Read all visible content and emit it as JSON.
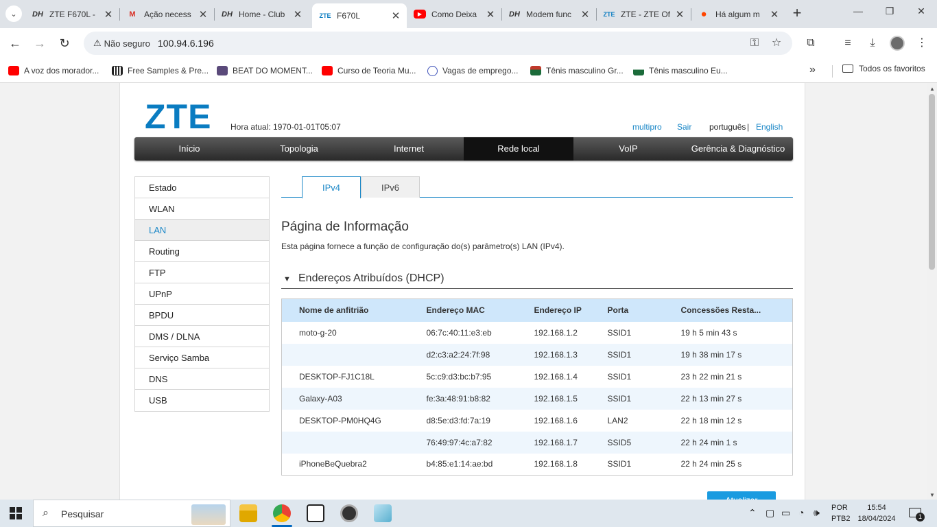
{
  "browser": {
    "tabs": [
      {
        "label": "ZTE F670L - ",
        "favicon": "DH"
      },
      {
        "label": "Ação necess",
        "favicon": "M"
      },
      {
        "label": "Home - Club",
        "favicon": "DH"
      },
      {
        "label": "F670L",
        "favicon": "ZTE"
      },
      {
        "label": "Como Deixa",
        "favicon": "▶"
      },
      {
        "label": "Modem func",
        "favicon": "DH"
      },
      {
        "label": "ZTE - ZTE Of",
        "favicon": "ZTE"
      },
      {
        "label": "Há algum m",
        "favicon": "●"
      }
    ],
    "security_label": "Não seguro",
    "url": "100.94.6.196",
    "bookmarks": [
      {
        "label": "A voz dos morador...",
        "color": "#ff0000"
      },
      {
        "label": "Free Samples & Pre...",
        "color": "#222222"
      },
      {
        "label": "BEAT DO MOMENT...",
        "color": "#5a4a7a"
      },
      {
        "label": "Curso de Teoria Mu...",
        "color": "#ff0000"
      },
      {
        "label": "Vagas de emprego...",
        "color": "#3b4fb8"
      },
      {
        "label": "Tênis masculino Gr...",
        "color": "#1b6b3a"
      },
      {
        "label": "Tênis masculino Eu...",
        "color": "#1b6b3a"
      }
    ],
    "all_bookmarks": "Todos os favoritos"
  },
  "header": {
    "logo": "ZTE",
    "time_label": "Hora atual: 1970-01-01T05:07",
    "user": "multipro",
    "logout": "Sair",
    "lang_pt": "português",
    "lang_sep": "|",
    "lang_en": "English"
  },
  "mainnav": [
    "Início",
    "Topologia",
    "Internet",
    "Rede local",
    "VoIP",
    "Gerência & Diagnóstico"
  ],
  "sidemenu": [
    "Estado",
    "WLAN",
    "LAN",
    "Routing",
    "FTP",
    "UPnP",
    "BPDU",
    "DMS / DLNA",
    "Serviço Samba",
    "DNS",
    "USB"
  ],
  "subtabs": [
    "IPv4",
    "IPv6"
  ],
  "page": {
    "title": "Página de Informação",
    "description": "Esta página fornece a função de configuração do(s) parâmetro(s) LAN (IPv4).",
    "section_title": "Endereços Atribuídos (DHCP)",
    "apply_label": "Atualizar"
  },
  "table": {
    "headers": [
      "Nome de anfitrião",
      "Endereço MAC",
      "Endereço IP",
      "Porta",
      "Concessões Resta..."
    ],
    "rows": [
      [
        "moto-g-20",
        "06:7c:40:11:e3:eb",
        "192.168.1.2",
        "SSID1",
        "19 h 5 min 43 s"
      ],
      [
        "",
        "d2:c3:a2:24:7f:98",
        "192.168.1.3",
        "SSID1",
        "19 h 38 min 17 s"
      ],
      [
        "DESKTOP-FJ1C18L",
        "5c:c9:d3:bc:b7:95",
        "192.168.1.4",
        "SSID1",
        "23 h 22 min 21 s"
      ],
      [
        "Galaxy-A03",
        "fe:3a:48:91:b8:82",
        "192.168.1.5",
        "SSID1",
        "22 h 13 min 27 s"
      ],
      [
        "DESKTOP-PM0HQ4G",
        "d8:5e:d3:fd:7a:19",
        "192.168.1.6",
        "LAN2",
        "22 h 18 min 12 s"
      ],
      [
        "",
        "76:49:97:4c:a7:82",
        "192.168.1.7",
        "SSID5",
        "22 h 24 min 1 s"
      ],
      [
        "iPhoneBeQuebra2",
        "b4:85:e1:14:ae:bd",
        "192.168.1.8",
        "SSID1",
        "22 h 24 min 25 s"
      ]
    ]
  },
  "taskbar": {
    "search_placeholder": "Pesquisar",
    "lang_line1": "POR",
    "lang_line2": "PTB2",
    "time": "15:54",
    "date": "18/04/2024",
    "notifications": "1"
  }
}
